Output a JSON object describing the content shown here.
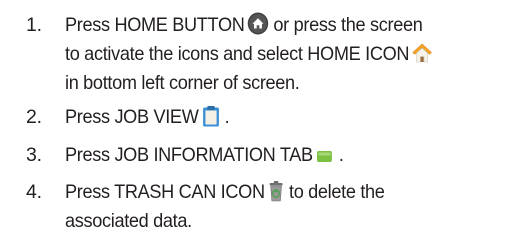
{
  "steps": [
    {
      "number": "1.",
      "line1_text": "Press HOME BUTTON",
      "line1_icon": "home-button-icon",
      "line1_after": " or press the screen",
      "line2_text": "to activate the icons and select HOME ICON",
      "line2_icon": "home-icon",
      "line3_text": "in bottom left corner of screen."
    },
    {
      "number": "2.",
      "text": "Press JOB VIEW",
      "icon": "clipboard-icon",
      "after": " ."
    },
    {
      "number": "3.",
      "text": "Press JOB INFORMATION TAB",
      "icon": "green-tab-icon",
      "after": " ."
    },
    {
      "number": "4.",
      "line1_text": "Press TRASH CAN ICON",
      "line1_icon": "trash-can-icon",
      "line1_after": " to delete the",
      "line2_text": "associated data."
    }
  ],
  "colors": {
    "text": "#231f20",
    "home_button_bg": "#3f3f3f",
    "home_icon_roof": "#f5a623",
    "clipboard": "#3a8fd6",
    "tab_green": "#7cc142",
    "trash": "#8a8a8a"
  }
}
